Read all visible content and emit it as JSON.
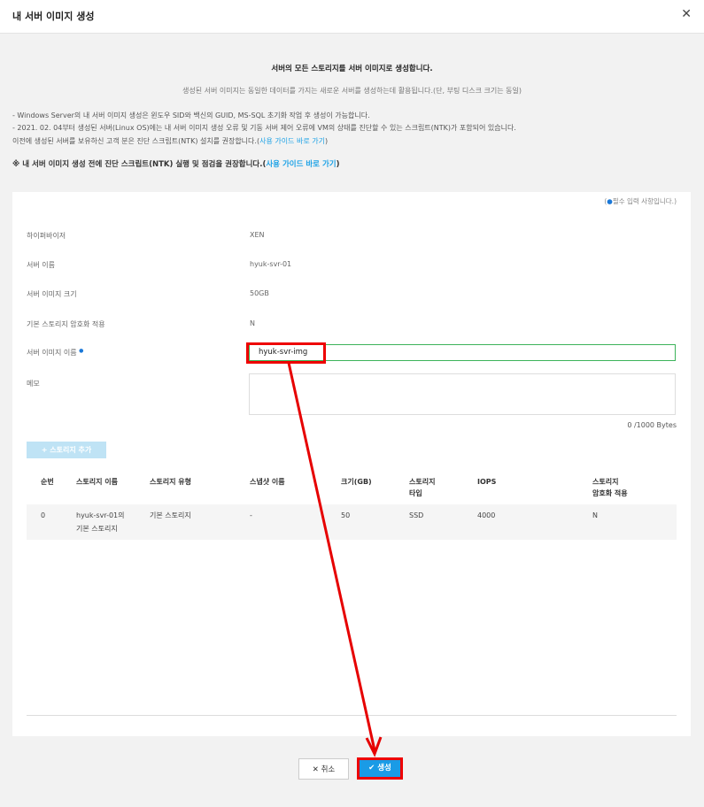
{
  "window": {
    "title": "내 서버 이미지 생성"
  },
  "notice": {
    "heading": "서버의 모든 스토리지를 서버 이미지로 생성합니다.",
    "sub": "생성된 서버 이미지는 동일한 데이터를 가지는 새로운 서버를 생성하는데 활용됩니다.(단, 부팅 디스크 크기는 동일)",
    "line1": "- Windows Server의 내 서버 이미지 생성은 윈도우 SID와 백신의 GUID, MS-SQL 초기화 작업 후 생성이 가능합니다.",
    "line2": "- 2021. 02. 04부터 생성된 서버(Linux OS)에는 내 서버 이미지 생성 오류 및 기동 서버 제어 오류에 VM의 상태를 진단할 수 있는 스크립트(NTK)가 포함되어 있습니다.",
    "line3_text": "이전에 생성된 서버를 보유하신 고객 분은 진단 스크립트(NTK) 설치를 권장합니다.(",
    "line3_link": "사용 가이드 바로 가기",
    "line3_end": ")",
    "warn_text": "※ 내 서버 이미지 생성 전에 진단 스크립트(NTK) 실행 및 점검을 권장합니다.(",
    "warn_link": "사용 가이드 바로 가기",
    "warn_end": ")"
  },
  "form": {
    "required_note_open": "(",
    "required_note": "필수 입력 사항입니다.)",
    "hypervisor_label": "하이퍼바이저",
    "hypervisor_value": "XEN",
    "server_name_label": "서버 이름",
    "server_name_value": "hyuk-svr-01",
    "image_size_label": "서버 이미지 크기",
    "image_size_value": "50GB",
    "encryption_label": "기본 스토리지 암호화 적용",
    "encryption_value": "N",
    "image_name_label": "서버 이미지 이름",
    "image_name_value": "hyuk-svr-img",
    "memo_label": "메모",
    "memo_counter": "0 /1000 Bytes",
    "add_storage_button": "+ 스토리지 추가"
  },
  "table": {
    "headers": {
      "no": "순번",
      "storage_name": "스토리지 이름",
      "storage_type": "스토리지 유형",
      "snapshot_name": "스냅샷 이름",
      "size": "크기(GB)",
      "disk_type_1": "스토리지",
      "disk_type_2": "타입",
      "iops": "IOPS",
      "encryption_1": "스토리지",
      "encryption_2": "암호화 적용"
    },
    "rows": [
      {
        "no": "0",
        "name_1": "hyuk-svr-01의",
        "name_2": "기본 스토리지",
        "type": "기본 스토리지",
        "snapshot": "-",
        "size": "50",
        "disk_type": "SSD",
        "iops": "4000",
        "encryption": "N"
      }
    ]
  },
  "footer": {
    "cancel_label": "✕ 취소",
    "create_label": "✔ 생성"
  },
  "colors": {
    "accent": "#1a9be6",
    "highlight": "#e60000",
    "valid_border": "#3cb35a"
  }
}
